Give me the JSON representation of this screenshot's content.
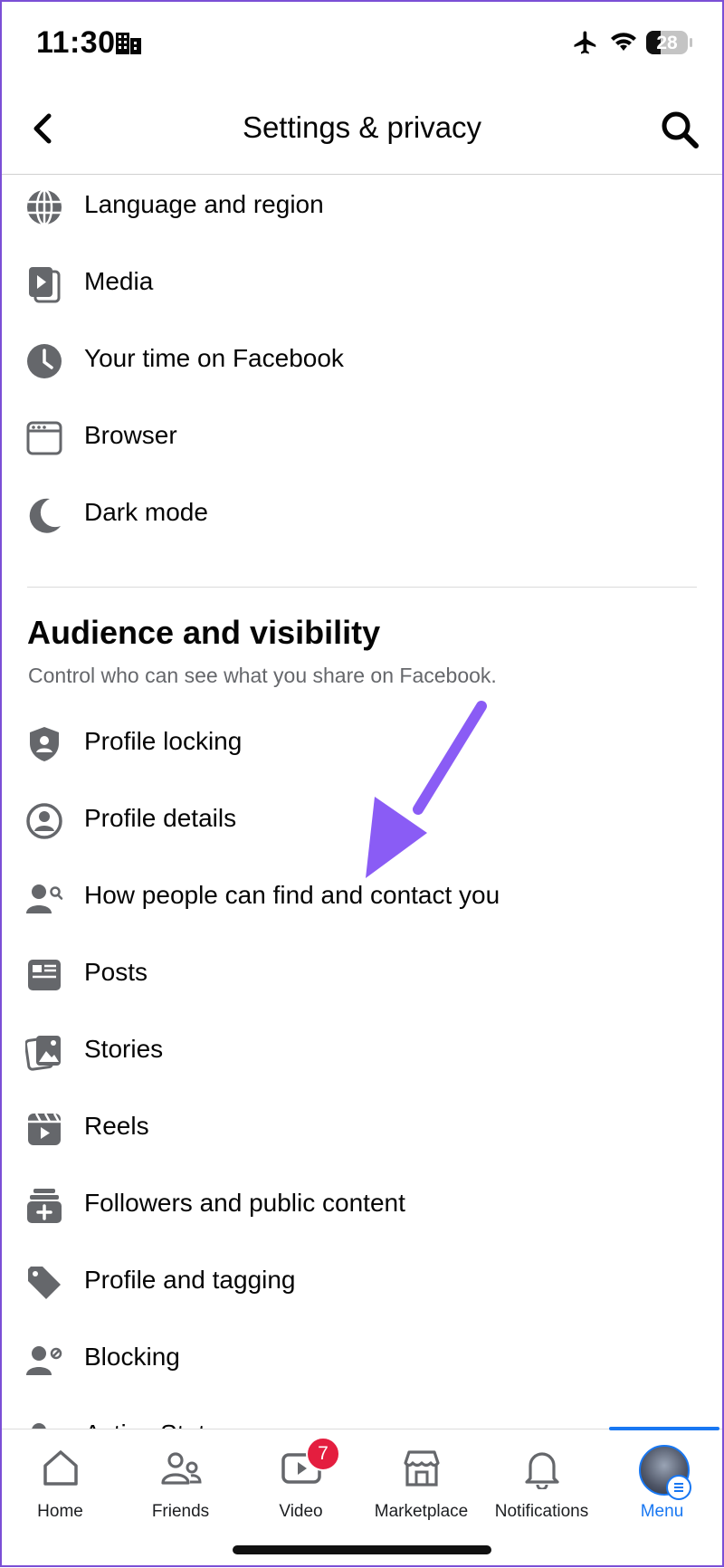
{
  "status_bar": {
    "time": "11:30",
    "battery": "28"
  },
  "header": {
    "title": "Settings & privacy"
  },
  "items_top": [
    {
      "label": "Language and region",
      "icon": "globe-icon"
    },
    {
      "label": "Media",
      "icon": "media-icon"
    },
    {
      "label": "Your time on Facebook",
      "icon": "clock-icon"
    },
    {
      "label": "Browser",
      "icon": "browser-icon"
    },
    {
      "label": "Dark mode",
      "icon": "moon-icon"
    }
  ],
  "section": {
    "title": "Audience and visibility",
    "subtitle": "Control who can see what you share on Facebook."
  },
  "items_section": [
    {
      "label": "Profile locking",
      "icon": "shield-icon"
    },
    {
      "label": "Profile details",
      "icon": "profile-icon"
    },
    {
      "label": "How people can find and contact you",
      "icon": "person-search-icon"
    },
    {
      "label": "Posts",
      "icon": "posts-icon"
    },
    {
      "label": "Stories",
      "icon": "stories-icon"
    },
    {
      "label": "Reels",
      "icon": "reels-icon"
    },
    {
      "label": "Followers and public content",
      "icon": "followers-icon"
    },
    {
      "label": "Profile and tagging",
      "icon": "tag-icon"
    },
    {
      "label": "Blocking",
      "icon": "block-icon"
    },
    {
      "label": "Active Status",
      "icon": "active-status-icon"
    }
  ],
  "nav": [
    {
      "label": "Home",
      "icon": "home-icon"
    },
    {
      "label": "Friends",
      "icon": "friends-icon"
    },
    {
      "label": "Video",
      "icon": "video-icon",
      "badge": "7"
    },
    {
      "label": "Marketplace",
      "icon": "marketplace-icon"
    },
    {
      "label": "Notifications",
      "icon": "bell-icon"
    },
    {
      "label": "Menu",
      "icon": "avatar",
      "active": true
    }
  ],
  "colors": {
    "accent": "#1877f2",
    "annotation_arrow": "#8a5cf5",
    "badge": "#e41e3f"
  }
}
